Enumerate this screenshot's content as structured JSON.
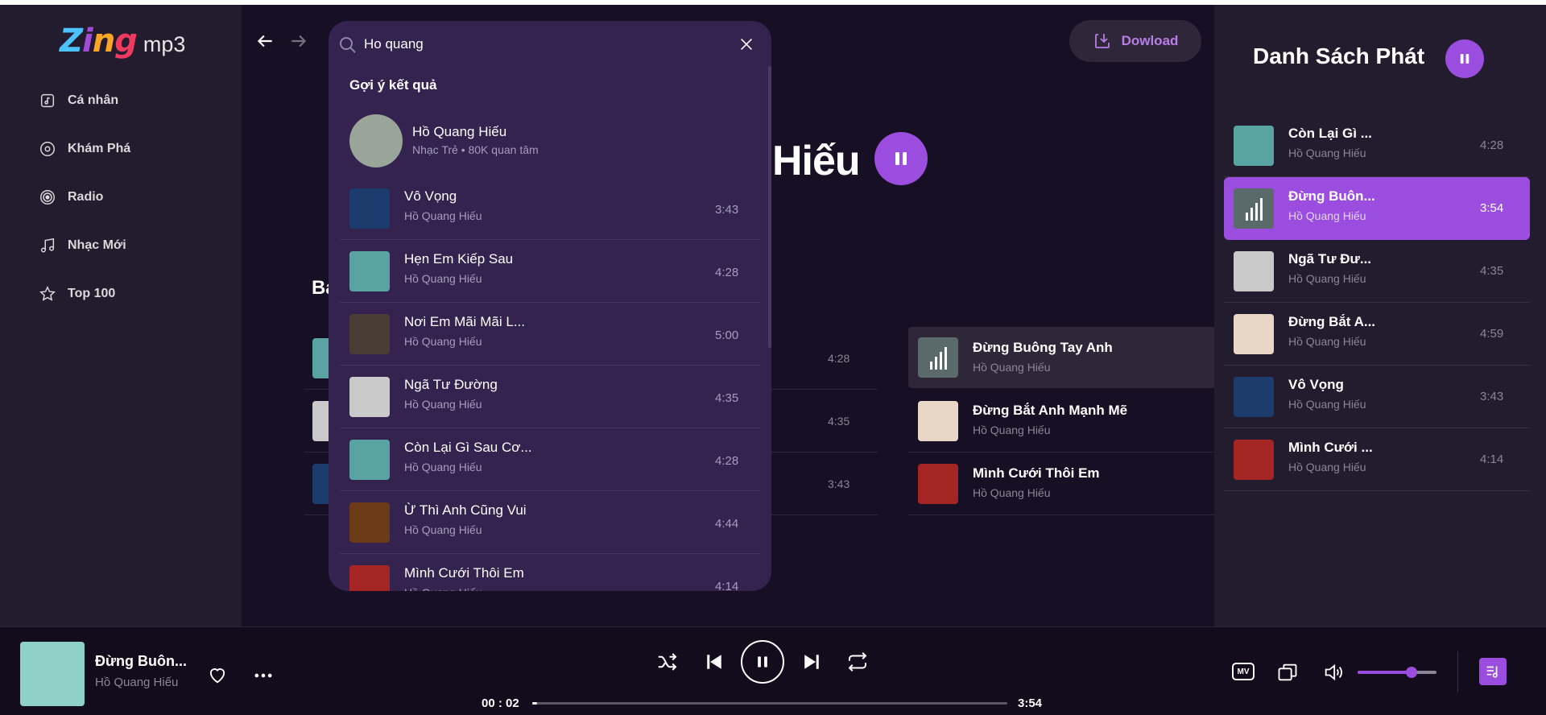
{
  "app": {
    "logo_main": "Zing",
    "logo_sub": "mp3"
  },
  "sidebar": {
    "items": [
      {
        "label": "Cá nhân",
        "icon": "library-music-icon"
      },
      {
        "label": "Khám Phá",
        "icon": "disc-icon"
      },
      {
        "label": "Radio",
        "icon": "radio-icon"
      },
      {
        "label": "Nhạc Mới",
        "icon": "music-note-icon"
      },
      {
        "label": "Top 100",
        "icon": "star-icon"
      }
    ]
  },
  "header": {
    "download_label": "Dowload"
  },
  "search": {
    "query": "Ho quang",
    "suggest_title": "Gợi ý kết quả",
    "artist": {
      "name": "Hồ Quang Hiếu",
      "meta": "Nhạc Trẻ • 80K quan tâm"
    },
    "results": [
      {
        "title": "Vô Vọng",
        "artist": "Hồ Quang Hiếu",
        "duration": "3:43",
        "thumb_color": "#1d3c6e"
      },
      {
        "title": "Hẹn Em Kiếp Sau",
        "artist": "Hồ Quang Hiếu",
        "duration": "4:28",
        "thumb_color": "#5aa3a3"
      },
      {
        "title": "Nơi Em Mãi Mãi L...",
        "artist": "Hồ Quang Hiếu",
        "duration": "5:00",
        "thumb_color": "#4a3d35"
      },
      {
        "title": "Ngã Tư Đường",
        "artist": "Hồ Quang Hiếu",
        "duration": "4:35",
        "thumb_color": "#c9c9c9"
      },
      {
        "title": "Còn Lại Gì Sau Cơ...",
        "artist": "Hồ Quang Hiếu",
        "duration": "4:28",
        "thumb_color": "#5aa3a3"
      },
      {
        "title": "Ừ Thì Anh Cũng Vui",
        "artist": "Hồ Quang Hiếu",
        "duration": "4:44",
        "thumb_color": "#6b3a16"
      },
      {
        "title": "Mình Cưới Thôi Em",
        "artist": "Hồ Quang Hiếu",
        "duration": "4:14",
        "thumb_color": "#a52424"
      }
    ]
  },
  "main": {
    "artist_title_visible": "Hiếu",
    "section_title_visible": "Ba",
    "left_list_durations": [
      "4:28",
      "4:35",
      "3:43"
    ],
    "right_list": [
      {
        "title": "Đừng Buông Tay Anh",
        "artist": "Hồ Quang Hiếu",
        "thumb_color": "#5a6a6a",
        "active": true
      },
      {
        "title": "Đừng Bắt Anh Mạnh Mẽ",
        "artist": "Hồ Quang Hiếu",
        "thumb_color": "#e8d7c6",
        "active": false
      },
      {
        "title": "Mình Cưới Thôi Em",
        "artist": "Hồ Quang Hiếu",
        "thumb_color": "#a52424",
        "active": false
      }
    ]
  },
  "queue": {
    "title": "Danh Sách Phát",
    "items": [
      {
        "title": "Còn Lại Gì ...",
        "artist": "Hồ Quang Hiếu",
        "duration": "4:28",
        "thumb_color": "#5aa3a3",
        "active": false
      },
      {
        "title": "Đừng Buôn...",
        "artist": "Hồ Quang Hiếu",
        "duration": "3:54",
        "thumb_color": "#5a6a6a",
        "active": true
      },
      {
        "title": "Ngã Tư Đư...",
        "artist": "Hồ Quang Hiếu",
        "duration": "4:35",
        "thumb_color": "#c9c9c9",
        "active": false
      },
      {
        "title": "Đừng Bắt A...",
        "artist": "Hồ Quang Hiếu",
        "duration": "4:59",
        "thumb_color": "#e8d7c6",
        "active": false
      },
      {
        "title": "Vô Vọng",
        "artist": "Hồ Quang Hiếu",
        "duration": "3:43",
        "thumb_color": "#1d3c6e",
        "active": false
      },
      {
        "title": "Mình Cưới ...",
        "artist": "Hồ Quang Hiếu",
        "duration": "4:14",
        "thumb_color": "#a52424",
        "active": false
      }
    ]
  },
  "player": {
    "title": "Đừng Buôn...",
    "artist": "Hồ Quang Hiếu",
    "elapsed": "00 : 02",
    "total": "3:54",
    "progress_fraction": 0.01,
    "volume_fraction": 0.68,
    "mv_label": "MV"
  },
  "colors": {
    "accent": "#9b4de0",
    "bg": "#170f23",
    "sidebar": "#231b2e",
    "search_bg": "#34224f"
  }
}
